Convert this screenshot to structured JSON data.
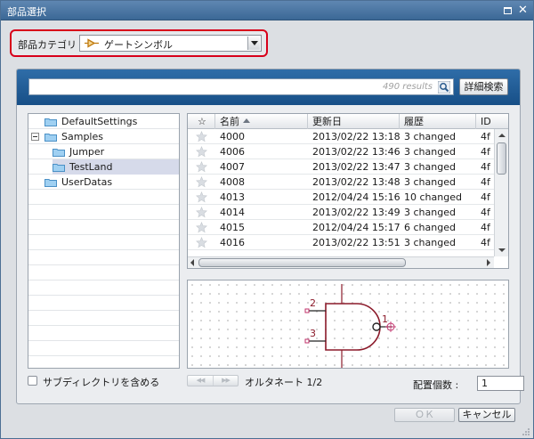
{
  "window": {
    "title": "部品選択"
  },
  "category": {
    "label": "部品カテゴリ",
    "value": "ゲートシンボル",
    "icon": "gate-symbol-icon"
  },
  "search": {
    "value": "",
    "results": "490 results",
    "advanced_label": "詳細検索"
  },
  "tree": [
    {
      "label": "DefaultSettings",
      "level": 0,
      "expandable": false,
      "selected": false
    },
    {
      "label": "Samples",
      "level": 0,
      "expandable": true,
      "selected": false
    },
    {
      "label": "Jumper",
      "level": 1,
      "expandable": false,
      "selected": false
    },
    {
      "label": "TestLand",
      "level": 1,
      "expandable": false,
      "selected": true
    },
    {
      "label": "UserDatas",
      "level": 0,
      "expandable": false,
      "selected": false
    }
  ],
  "grid": {
    "columns": [
      "☆",
      "名前",
      "更新日",
      "履歴",
      "ID"
    ],
    "rows": [
      {
        "name": "4000",
        "updated": "2013/02/22 13:18",
        "history": "3 changed",
        "id": "4f"
      },
      {
        "name": "4006",
        "updated": "2013/02/22 13:46",
        "history": "3 changed",
        "id": "4f"
      },
      {
        "name": "4007",
        "updated": "2013/02/22 13:47",
        "history": "3 changed",
        "id": "4f"
      },
      {
        "name": "4008",
        "updated": "2013/02/22 13:48",
        "history": "3 changed",
        "id": "4f"
      },
      {
        "name": "4013",
        "updated": "2012/04/24 15:16",
        "history": "10 changed",
        "id": "4f"
      },
      {
        "name": "4014",
        "updated": "2013/02/22 13:49",
        "history": "3 changed",
        "id": "4f"
      },
      {
        "name": "4015",
        "updated": "2012/04/24 15:17",
        "history": "6 changed",
        "id": "4f"
      },
      {
        "name": "4016",
        "updated": "2013/02/22 13:51",
        "history": "3 changed",
        "id": "4f"
      }
    ]
  },
  "preview": {
    "pin_labels": [
      "2",
      "3",
      "1"
    ],
    "symbol": "nand-gate"
  },
  "include_subdirs": {
    "label": "サブディレクトリを含める",
    "checked": false
  },
  "alternate": {
    "label": "オルタネート 1/2"
  },
  "placement": {
    "label": "配置個数 :",
    "value": "1"
  },
  "buttons": {
    "ok": "ＯＫ",
    "cancel": "キャンセル"
  },
  "colors": {
    "title_bar": "#4a77a5",
    "panel_bar": "#1f5d98",
    "highlight_border": "#d8001a",
    "pin": "#8b1a2a"
  }
}
